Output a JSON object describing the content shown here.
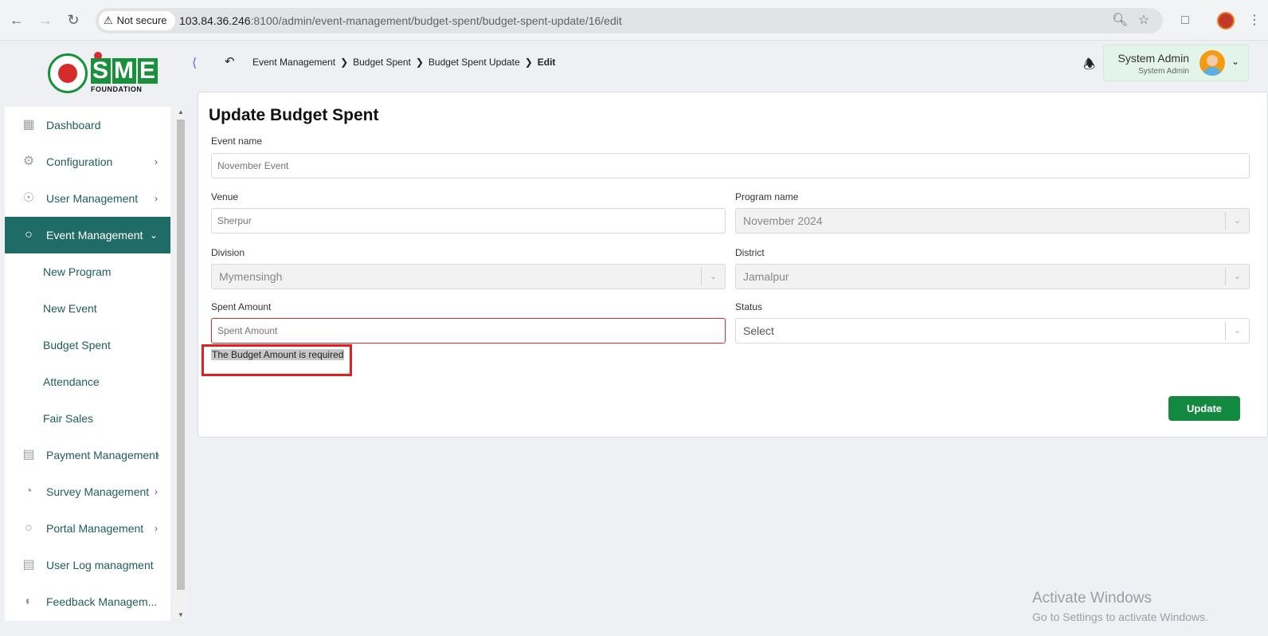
{
  "browser": {
    "security_label": "Not secure",
    "url_host": "103.84.36.246",
    "url_rest": ":8100/admin/event-management/budget-spent/budget-spent-update/16/edit"
  },
  "logo": {
    "letters": [
      "S",
      "M",
      "E"
    ],
    "subtitle": "FOUNDATION"
  },
  "sidebar": {
    "items": [
      {
        "label": "Dashboard",
        "icon": "grid-icon"
      },
      {
        "label": "Configuration",
        "icon": "config-icon"
      },
      {
        "label": "User Management",
        "icon": "shield-icon"
      },
      {
        "label": "Event Management",
        "icon": "lock-icon"
      },
      {
        "label": "Payment Management",
        "icon": "payment-icon"
      },
      {
        "label": "Survey Management",
        "icon": "pie-icon"
      },
      {
        "label": "Portal Management",
        "icon": "lock-icon"
      },
      {
        "label": "User Log managment",
        "icon": "log-icon"
      },
      {
        "label": "Feedback Managem...",
        "icon": "feedback-icon"
      }
    ],
    "submenu": [
      {
        "label": "New Program"
      },
      {
        "label": "New Event"
      },
      {
        "label": "Budget Spent"
      },
      {
        "label": "Attendance"
      },
      {
        "label": "Fair Sales"
      }
    ]
  },
  "breadcrumb": {
    "items": [
      "Event Management",
      "Budget Spent",
      "Budget Spent Update"
    ],
    "current": "Edit"
  },
  "user": {
    "name": "System Admin",
    "role": "System Admin"
  },
  "form": {
    "title": "Update Budget Spent",
    "event_name": {
      "label": "Event name",
      "placeholder": "November Event"
    },
    "venue": {
      "label": "Venue",
      "placeholder": "Sherpur"
    },
    "program_name": {
      "label": "Program name",
      "value": "November 2024"
    },
    "division": {
      "label": "Division",
      "value": "Mymensingh"
    },
    "district": {
      "label": "District",
      "value": "Jamalpur"
    },
    "spent_amount": {
      "label": "Spent Amount",
      "placeholder": "Spent Amount"
    },
    "status": {
      "label": "Status",
      "value": "Select"
    },
    "error": "The Budget Amount is required",
    "submit_label": "Update"
  },
  "watermark": {
    "title": "Activate Windows",
    "subtitle": "Go to Settings to activate Windows."
  },
  "colors": {
    "primary": "#1f6b66",
    "button": "#13893f",
    "error": "#e02b2b"
  }
}
